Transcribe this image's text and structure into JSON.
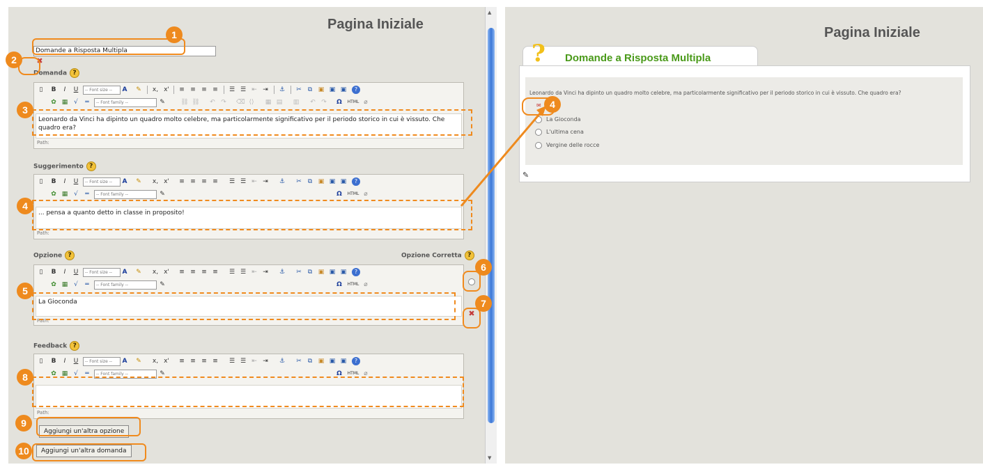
{
  "left": {
    "page_title": "Pagina Iniziale",
    "title_value": "Domande a Risposta Multipla",
    "labels": {
      "domanda": "Domanda",
      "suggerimento": "Suggerimento",
      "opzione": "Opzione",
      "opzione_corretta": "Opzione Corretta",
      "feedback": "Feedback"
    },
    "toolbar": {
      "font_size": "-- Font size --",
      "font_family": "-- Font family --",
      "html": "HTML"
    },
    "path_label": "Path:",
    "editors": {
      "domanda_text": "Leonardo da Vinci ha dipinto un quadro molto celebre, ma particolarmente significativo per il periodo storico in cui è vissuto. Che quadro era?",
      "suggerimento_text": "... pensa a quanto detto in classe in proposito!",
      "opzione_text": "La Gioconda",
      "feedback_text": ""
    },
    "buttons": {
      "add_option": "Aggiungi un'altra opzione",
      "add_question": "Aggiungi un'altra domanda"
    },
    "callouts": [
      "1",
      "2",
      "3",
      "4",
      "5",
      "6",
      "7",
      "8",
      "9",
      "10"
    ]
  },
  "right": {
    "page_title": "Pagina Iniziale",
    "tab_title": "Domande a Risposta Multipla",
    "question": "Leonardo da Vinci ha dipinto un quadro molto celebre, ma particolarmente significativo per il periodo storico in cui è vissuto. Che quadro era?",
    "options": [
      "La Gioconda",
      "L'ultima cena",
      "Vergine delle rocce"
    ],
    "callout": "4"
  },
  "colors": {
    "accent": "#ee8a1e",
    "tab_title": "#4a9a1a",
    "panel": "#e3e2dc"
  }
}
